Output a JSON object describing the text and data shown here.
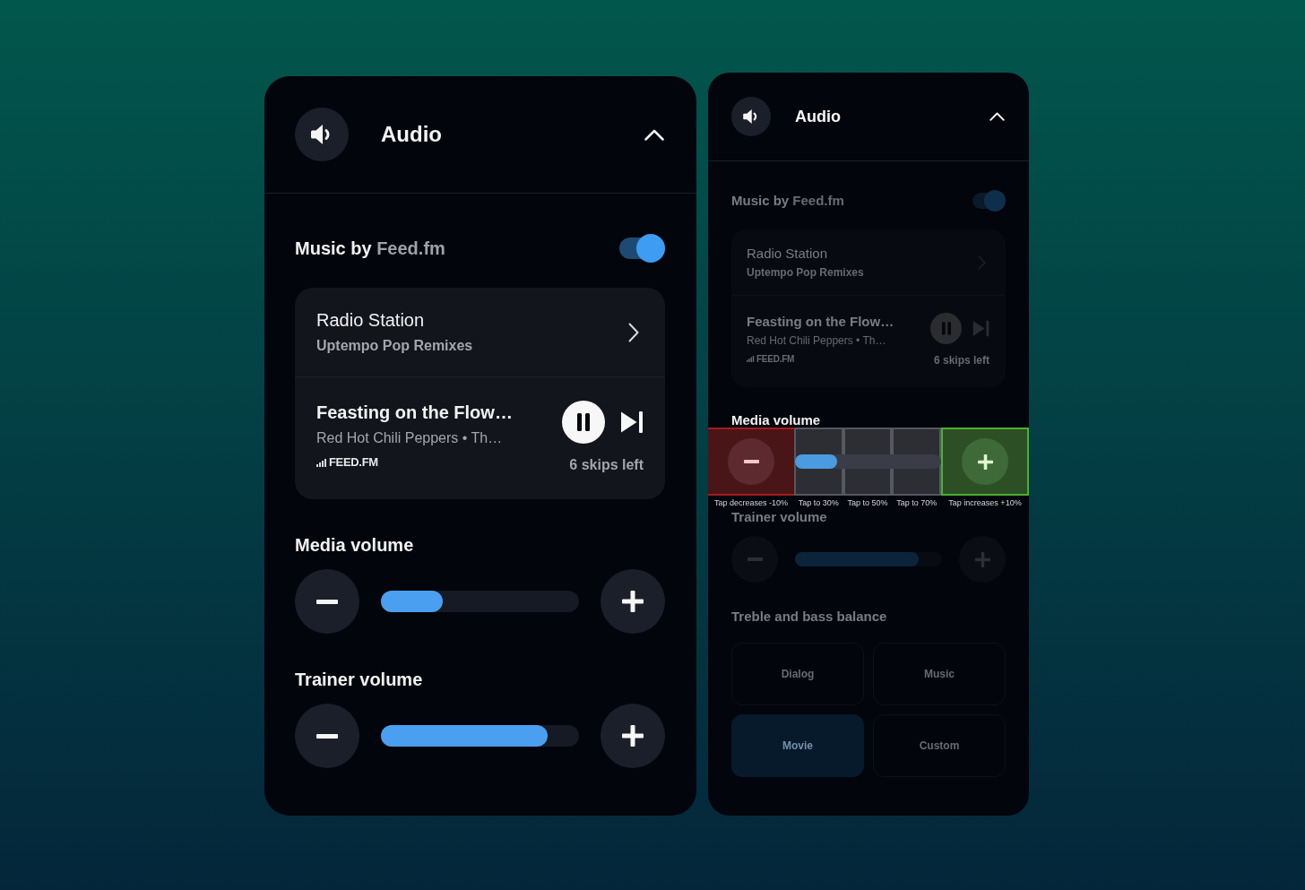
{
  "panels": [
    {
      "kind": "full",
      "header": {
        "title": "Audio",
        "expanded": true
      },
      "music": {
        "label": "Music by",
        "source": "Feed.fm",
        "on": true
      },
      "card": {
        "station": {
          "title": "Radio Station",
          "subtitle": "Uptempo Pop Remixes"
        },
        "track": {
          "title": "Feasting on the Flow…",
          "artist": "Red Hot Chili Peppers • Th…",
          "brand": "FEED.FM",
          "playing": true,
          "skips": "6 skips left"
        }
      },
      "volumes": [
        {
          "label": "Media volume",
          "level": 0.31
        },
        {
          "label": "Trainer volume",
          "level": 0.84
        }
      ]
    },
    {
      "kind": "compact",
      "dimmed": true,
      "header": {
        "title": "Audio",
        "expanded": true
      },
      "music": {
        "label": "Music by",
        "source": "Feed.fm",
        "on": true
      },
      "card": {
        "station": {
          "title": "Radio Station",
          "subtitle": "Uptempo Pop Remixes"
        },
        "track": {
          "title": "Feasting on the Flow…",
          "artist": "Red Hot Chili Peppers • Th…",
          "brand": "FEED.FM",
          "playing": true,
          "skips": "6 skips left"
        }
      },
      "volumes": [
        {
          "label": "Media volume",
          "level": 0.29,
          "tap_zones": [
            {
              "kind": "decrease",
              "label": "Tap decreases -10%"
            },
            {
              "kind": "preset",
              "label": "Tap to 30%"
            },
            {
              "kind": "preset",
              "label": "Tap to 50%"
            },
            {
              "kind": "preset",
              "label": "Tap to 70%"
            },
            {
              "kind": "increase",
              "label": "Tap increases +10%"
            }
          ]
        },
        {
          "label": "Trainer volume",
          "level": 0.84
        }
      ],
      "balance": {
        "label": "Treble and bass balance",
        "options": [
          {
            "label": "Dialog",
            "selected": false
          },
          {
            "label": "Music",
            "selected": false
          },
          {
            "label": "Movie",
            "selected": true
          },
          {
            "label": "Custom",
            "selected": false
          }
        ]
      }
    }
  ]
}
